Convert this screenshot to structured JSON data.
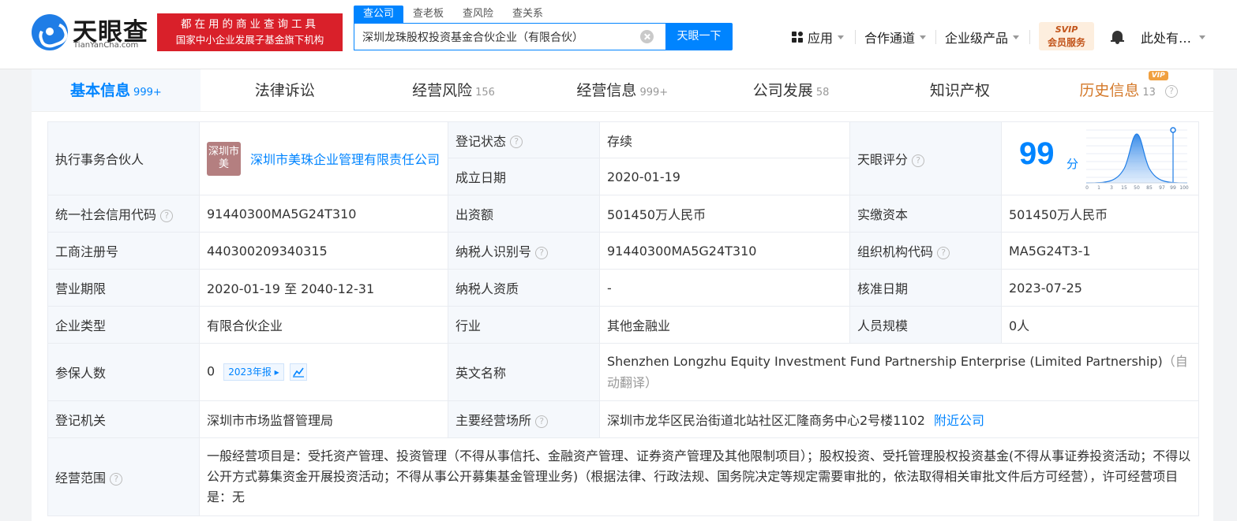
{
  "header": {
    "logo_name": "天眼查",
    "logo_domain": "TianYanCha.com",
    "slogan_line1": "都在用的商业查询工具",
    "slogan_line2": "国家中小企业发展子基金旗下机构",
    "search_tabs": [
      "查公司",
      "查老板",
      "查风险",
      "查关系"
    ],
    "search_value": "深圳龙珠股权投资基金合伙企业（有限合伙）",
    "search_button": "天眼一下",
    "nav_apps": "应用",
    "nav_channel": "合作通道",
    "nav_enterprise": "企业级产品",
    "svip_line1": "SVIP",
    "svip_line2": "会员服务",
    "user_name": "此处有…"
  },
  "tabs": [
    {
      "label": "基本信息",
      "count": "999+"
    },
    {
      "label": "法律诉讼",
      "count": ""
    },
    {
      "label": "经营风险",
      "count": "156"
    },
    {
      "label": "经营信息",
      "count": "999+"
    },
    {
      "label": "公司发展",
      "count": "58"
    },
    {
      "label": "知识产权",
      "count": ""
    },
    {
      "label": "历史信息",
      "count": "13",
      "badge": "VIP"
    }
  ],
  "info": {
    "partner_label": "执行事务合伙人",
    "partner_avatar": "深圳市美",
    "partner_name": "深圳市美珠企业管理有限责任公司",
    "status_label": "登记状态",
    "status_value": "存续",
    "found_label": "成立日期",
    "found_value": "2020-01-19",
    "score_label": "天眼评分",
    "score_value": "99",
    "score_unit": "分",
    "credit_label": "统一社会信用代码",
    "credit_value": "91440300MA5G24T310",
    "contrib_label": "出资额",
    "contrib_value": "501450万人民币",
    "paid_label": "实缴资本",
    "paid_value": "501450万人民币",
    "reg_no_label": "工商注册号",
    "reg_no_value": "440300209340315",
    "taxid_label": "纳税人识别号",
    "taxid_value": "91440300MA5G24T310",
    "org_code_label": "组织机构代码",
    "org_code_value": "MA5G24T3-1",
    "term_label": "营业期限",
    "term_value": "2020-01-19 至 2040-12-31",
    "tax_qual_label": "纳税人资质",
    "tax_qual_value": "-",
    "approve_label": "核准日期",
    "approve_value": "2023-07-25",
    "type_label": "企业类型",
    "type_value": "有限合伙企业",
    "industry_label": "行业",
    "industry_value": "其他金融业",
    "staff_label": "人员规模",
    "staff_value": "0人",
    "insured_label": "参保人数",
    "insured_value": "0",
    "insured_report": "2023年报",
    "english_label": "英文名称",
    "english_value": "Shenzhen Longzhu Equity Investment Fund Partnership Enterprise (Limited Partnership)",
    "english_note": "（自动翻译）",
    "authority_label": "登记机关",
    "authority_value": "深圳市市场监督管理局",
    "address_label": "主要经营场所",
    "address_value": "深圳市龙华区民治街道北站社区汇隆商务中心2号楼1102",
    "nearby_link": "附近公司",
    "scope_label": "经营范围",
    "scope_value": "一般经营项目是：受托资产管理、投资管理（不得从事信托、金融资产管理、证券资产管理及其他限制项目）；股权投资、受托管理股权投资基金(不得从事证券投资活动；不得以公开方式募集资金开展投资活动；不得从事公开募集基金管理业务)（根据法律、行政法规、国务院决定等规定需要审批的，依法取得相关审批文件后方可经营），许可经营项目是：无"
  },
  "score_axis": [
    "0",
    "1",
    "3",
    "15",
    "50",
    "85",
    "97",
    "99",
    "100"
  ],
  "colors": {
    "brand_blue": "#0084ff",
    "slogan_red": "#d9202a",
    "status_green": "#1ea561",
    "avatar": "#b47f80"
  }
}
